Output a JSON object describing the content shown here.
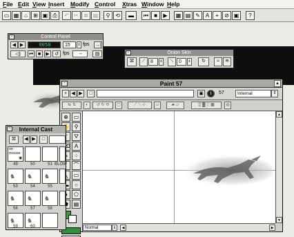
{
  "menu": [
    "File",
    "Edit",
    "View",
    "Insert",
    "Modify",
    "Control",
    "Xtras",
    "Window",
    "Help"
  ],
  "control_panel": {
    "title": "Control Panel",
    "frame_counter": "0058",
    "tempo_value": "15",
    "tempo_unit": "fps",
    "fps_label": "fps",
    "fps_value": "--"
  },
  "onion_skin": {
    "title": "Onion Skin",
    "preceding_value": "8",
    "following_value": "0"
  },
  "paint": {
    "title": "Paint 57",
    "member_name": "",
    "member_number": "57",
    "palette": "Internal",
    "ink": "Normal"
  },
  "cast": {
    "title": "Internal Cast",
    "cells": [
      {
        "label": "on mouse",
        "number": "49"
      },
      {
        "label": "",
        "number": "50"
      },
      {
        "label": "",
        "number": "51"
      },
      {
        "label": "",
        "number": "BLOW"
      },
      {
        "label": "",
        "number": "53"
      },
      {
        "label": "",
        "number": "54"
      },
      {
        "label": "",
        "number": "55"
      },
      {
        "label": "",
        "number": "56"
      },
      {
        "label": "",
        "number": "57"
      },
      {
        "label": "",
        "number": "58"
      },
      {
        "label": "",
        "number": "59"
      },
      {
        "label": "",
        "number": "60"
      }
    ]
  },
  "colors": {
    "stage_dark": "#0e0e10",
    "title_bar": "#8e8e8a",
    "counter_green": "#3fd07a",
    "foreground_swatch": "#3d9a3d",
    "horse_grey": "#9a9a9a"
  }
}
